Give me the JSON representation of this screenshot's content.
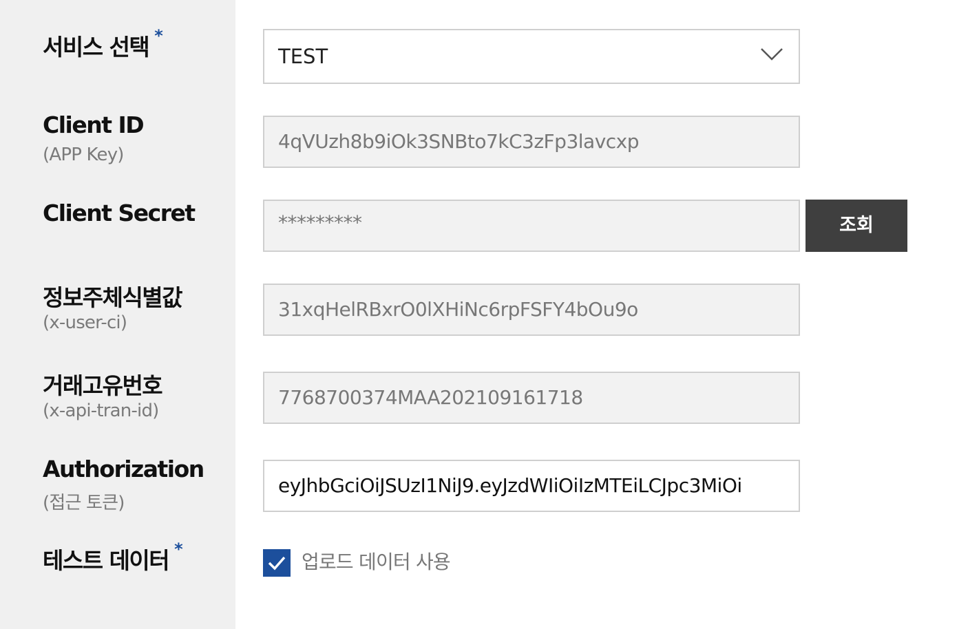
{
  "service": {
    "label": "서비스 선택",
    "required_mark": "*",
    "selected_value": "TEST"
  },
  "client_id": {
    "label": "Client ID",
    "sublabel": "(APP Key)",
    "value": "4qVUzh8b9iOk3SNBto7kC3zFp3lavcxp"
  },
  "client_secret": {
    "label": "Client Secret",
    "value": "*********",
    "button_label": "조회"
  },
  "user_ci": {
    "label": "정보주체식별값",
    "sublabel": "(x-user-ci)",
    "value": "31xqHelRBxrO0lXHiNc6rpFSFY4bOu9o"
  },
  "tran_id": {
    "label": "거래고유번호",
    "sublabel": "(x-api-tran-id)",
    "value": "7768700374MAA202109161718"
  },
  "authorization": {
    "label": "Authorization",
    "sublabel": "(접근 토큰)",
    "value": "eyJhbGciOiJSUzI1NiJ9.eyJzdWIiOiIzMTEiLCJpc3MiOi"
  },
  "test_data": {
    "label": "테스트 데이터",
    "required_mark": "*",
    "checkbox_label": "업로드 데이터 사용",
    "checked": true
  },
  "colors": {
    "label_bg": "#f0f0f0",
    "accent": "#1c4f9c",
    "button_bg": "#3f3f3f",
    "readonly_bg": "#f2f2f2"
  }
}
